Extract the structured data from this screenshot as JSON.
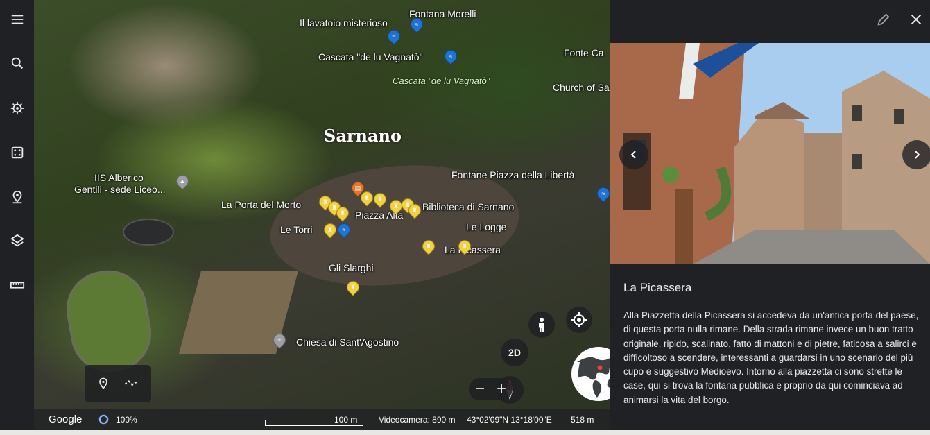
{
  "sidebar": {
    "items": [
      {
        "icon": "menu-icon"
      },
      {
        "icon": "search-icon"
      },
      {
        "icon": "voyager-wheel-icon"
      },
      {
        "icon": "dice-icon"
      },
      {
        "icon": "projects-pin-icon"
      },
      {
        "icon": "layers-icon"
      },
      {
        "icon": "ruler-icon"
      }
    ]
  },
  "map": {
    "town_name": "Sarnano",
    "labels": {
      "lavatoio": "Il lavatoio misterioso",
      "fontana_morelli": "Fontana Morelli",
      "cascata": "Cascata \"de lu Vagnatò\"",
      "cascata_it": "Cascata \"de lu Vagnatò\"",
      "fonte": "Fonte Ca",
      "church": "Church of Sa",
      "iis_1": "IIS Alberico",
      "iis_2": "Gentili - sede Liceo...",
      "fontane": "Fontane Piazza della Libertà",
      "porta": "La Porta del Morto",
      "piazza_alta": "Piazza Alta",
      "biblioteca": "Biblioteca di Sarnano",
      "torri": "Le Torri",
      "logge": "Le Logge",
      "picassera": "La Picassera",
      "slarghi": "Gli Slarghi",
      "chiesa": "Chiesa di Sant'Agostino"
    },
    "controls": {
      "view_2d": "2D",
      "zoom_out": "−",
      "zoom_in": "+"
    }
  },
  "status_bar": {
    "brand": "Google",
    "loading": "100%",
    "scale": "100 m",
    "camera": "Videocamera: 890 m",
    "coords": "43°02'09\"N 13°18'00\"E",
    "elevation": "518 m"
  },
  "panel": {
    "title": "La Picassera",
    "description": "Alla Piazzetta della Picassera si accedeva da un'antica porta del paese, di questa porta nulla rimane.  Della strada rimane invece un buon tratto originale, ripido, scalinato, fatto di mattoni e di pietre, faticosa a salirci e difficoltoso a scendere, interessanti a guardarsi in uno scenario del più cupo e suggestivo Medioevo. Intorno alla piazzetta ci sono strette le case, qui si trova la fontana pubblica e proprio da qui cominciava ad animarsi la vita del borgo."
  },
  "colors": {
    "chrome": "#202124",
    "pin_yellow": "#f4d03f",
    "pin_blue": "#1e73d6",
    "pin_orange": "#e0762b"
  }
}
